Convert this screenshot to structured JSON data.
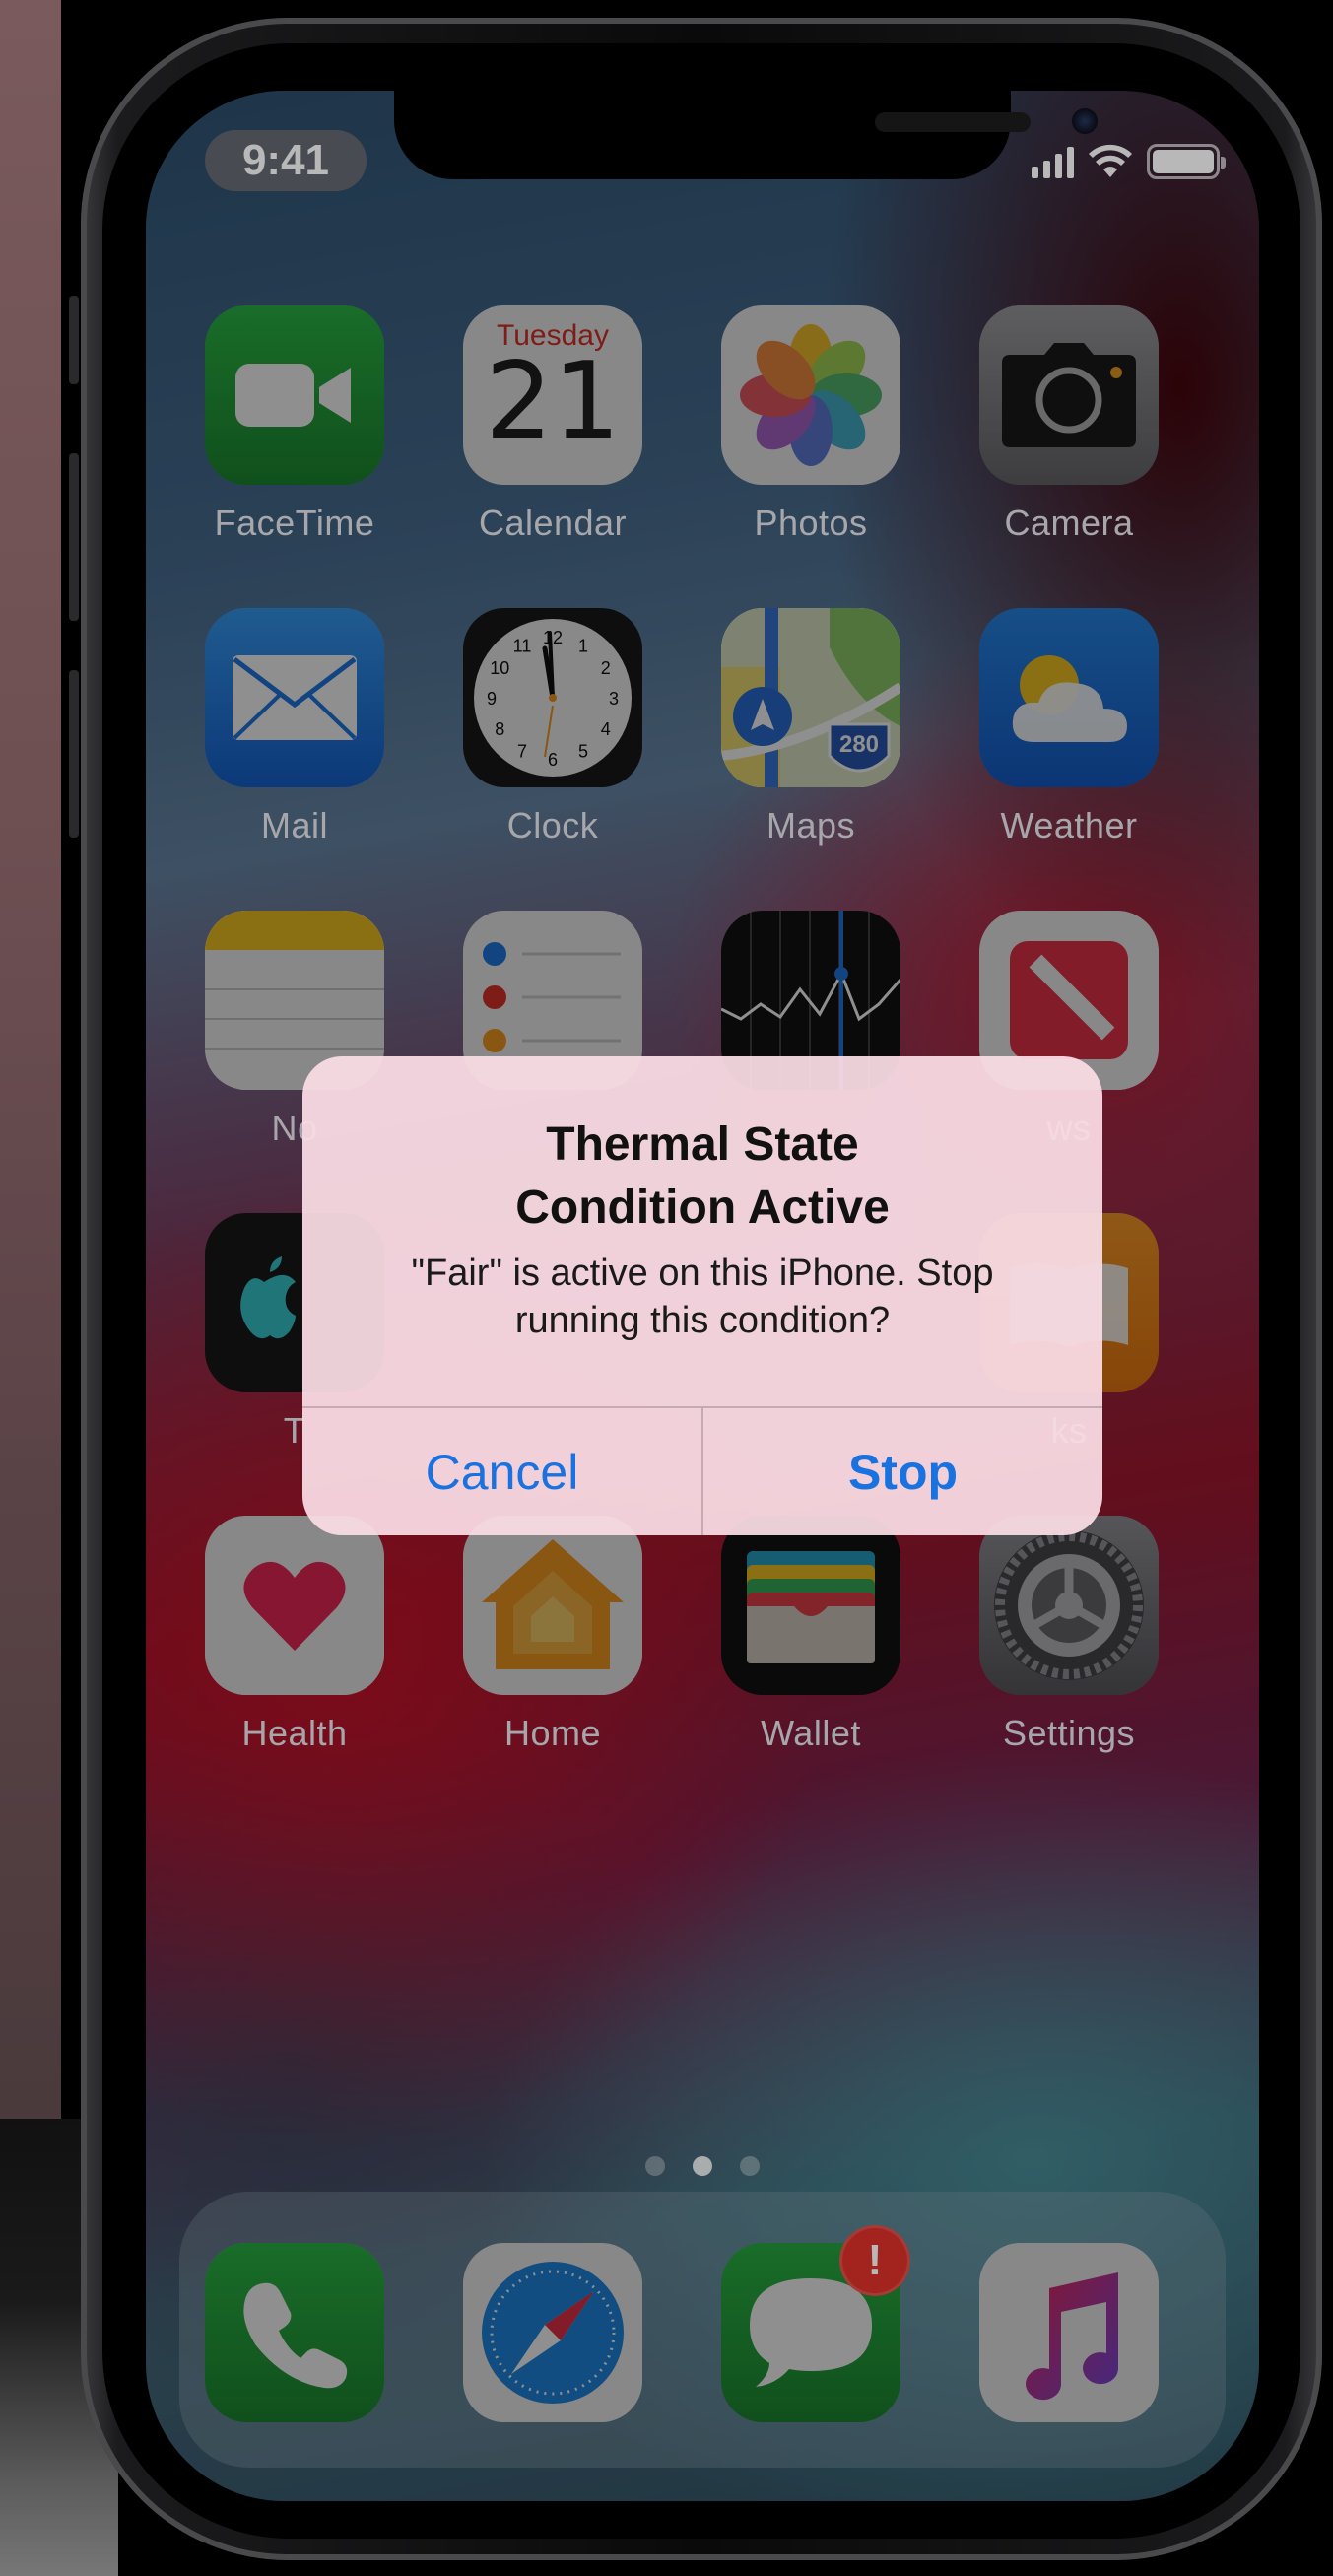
{
  "status_bar": {
    "time": "9:41"
  },
  "home_screen": {
    "apps": [
      {
        "label": "FaceTime",
        "icon": "facetime-icon"
      },
      {
        "label": "Calendar",
        "icon": "calendar-icon",
        "day": "Tuesday",
        "date": "21"
      },
      {
        "label": "Photos",
        "icon": "photos-icon"
      },
      {
        "label": "Camera",
        "icon": "camera-icon"
      },
      {
        "label": "Mail",
        "icon": "mail-icon"
      },
      {
        "label": "Clock",
        "icon": "clock-icon"
      },
      {
        "label": "Maps",
        "icon": "maps-icon",
        "shield": "280"
      },
      {
        "label": "Weather",
        "icon": "weather-icon"
      },
      {
        "label": "No",
        "icon": "notes-icon"
      },
      {
        "label": "",
        "icon": "reminders-icon"
      },
      {
        "label": "",
        "icon": "stocks-icon"
      },
      {
        "label": "ws",
        "icon": "news-icon"
      },
      {
        "label": "T",
        "icon": "apple-tv-icon"
      },
      {
        "label": "ks",
        "icon": "books-icon"
      },
      {
        "label": "Health",
        "icon": "health-icon"
      },
      {
        "label": "Home",
        "icon": "home-icon"
      },
      {
        "label": "Wallet",
        "icon": "wallet-icon"
      },
      {
        "label": "Settings",
        "icon": "settings-icon"
      }
    ],
    "clock_numbers": [
      "12",
      "1",
      "2",
      "3",
      "4",
      "5",
      "6",
      "7",
      "8",
      "9",
      "10",
      "11"
    ],
    "page_count": 3,
    "active_page": 1
  },
  "dock": {
    "apps": [
      {
        "icon": "phone-icon"
      },
      {
        "icon": "safari-icon"
      },
      {
        "icon": "messages-icon",
        "badge": "!"
      },
      {
        "icon": "music-icon"
      }
    ]
  },
  "alert": {
    "title_line1": "Thermal State",
    "title_line2": "Condition Active",
    "message_line1": "\"Fair\" is active on this iPhone. Stop",
    "message_line2": "running this condition?",
    "cancel_label": "Cancel",
    "stop_label": "Stop"
  },
  "colors": {
    "alert_button": "#1a72e0",
    "badge": "#e2332b",
    "calendar_day": "#e0352b"
  }
}
